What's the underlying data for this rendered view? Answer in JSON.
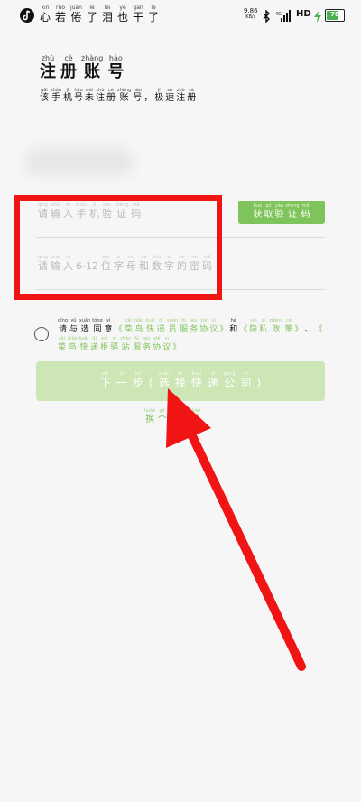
{
  "status_bar": {
    "song": [
      {
        "py": "xīn",
        "han": "心"
      },
      {
        "py": "ruò",
        "han": "若"
      },
      {
        "py": "juàn",
        "han": "倦"
      },
      {
        "py": "le",
        "han": "了"
      },
      {
        "py": "lèi",
        "han": "泪"
      },
      {
        "py": "yě",
        "han": "也"
      },
      {
        "py": "gān",
        "han": "干"
      },
      {
        "py": "le",
        "han": "了"
      }
    ],
    "net_speed_value": "9.86",
    "net_speed_unit": "KB/s",
    "hd": "HD",
    "battery": "78",
    "battery_level": 0.78,
    "icons": [
      "music-icon",
      "bluetooth-icon",
      "signal-icon",
      "charging-icon",
      "battery-icon"
    ]
  },
  "title": [
    {
      "py": "zhù",
      "han": "注"
    },
    {
      "py": "cè",
      "han": "册"
    },
    {
      "py": "zhàng",
      "han": "账"
    },
    {
      "py": "hào",
      "han": "号"
    }
  ],
  "subtitle": [
    {
      "py": "gāi",
      "han": "该"
    },
    {
      "py": "shǒu",
      "han": "手"
    },
    {
      "py": "jī",
      "han": "机"
    },
    {
      "py": "hào",
      "han": "号"
    },
    {
      "py": "wèi",
      "han": "未"
    },
    {
      "py": "zhù",
      "han": "注"
    },
    {
      "py": "cè",
      "han": "册"
    },
    {
      "py": "zhàng",
      "han": "账"
    },
    {
      "py": "hào",
      "han": "号"
    },
    {
      "py": "",
      "han": "，"
    },
    {
      "py": "jí",
      "han": "极"
    },
    {
      "py": "sù",
      "han": "速"
    },
    {
      "py": "zhù",
      "han": "注"
    },
    {
      "py": "cè",
      "han": "册"
    }
  ],
  "code_placeholder": [
    {
      "py": "qǐng",
      "han": "请"
    },
    {
      "py": "shū",
      "han": "输"
    },
    {
      "py": "rù",
      "han": "入"
    },
    {
      "py": "shǒu",
      "han": "手"
    },
    {
      "py": "jī",
      "han": "机"
    },
    {
      "py": "yàn",
      "han": "验"
    },
    {
      "py": "zhèng",
      "han": "证"
    },
    {
      "py": "mǎ",
      "han": "码"
    }
  ],
  "password_placeholder": [
    {
      "py": "qǐng",
      "han": "请"
    },
    {
      "py": "shū",
      "han": "输"
    },
    {
      "py": "rù",
      "han": "入"
    },
    {
      "py": "",
      "han": "6-12"
    },
    {
      "py": "wèi",
      "han": "位"
    },
    {
      "py": "zì",
      "han": "字"
    },
    {
      "py": "mǔ",
      "han": "母"
    },
    {
      "py": "hé",
      "han": "和"
    },
    {
      "py": "shù",
      "han": "数"
    },
    {
      "py": "zì",
      "han": "字"
    },
    {
      "py": "de",
      "han": "的"
    },
    {
      "py": "mì",
      "han": "密"
    },
    {
      "py": "mǎ",
      "han": "码"
    }
  ],
  "get_code_button": [
    {
      "py": "huò",
      "han": "获"
    },
    {
      "py": "qǔ",
      "han": "取"
    },
    {
      "py": "yàn",
      "han": "验"
    },
    {
      "py": "zhèng",
      "han": "证"
    },
    {
      "py": "mǎ",
      "han": "码"
    }
  ],
  "agreement": {
    "prefix": [
      {
        "py": "qǐng",
        "han": "请"
      },
      {
        "py": "yǔ",
        "han": "与"
      },
      {
        "py": "xuǎn",
        "han": "选"
      },
      {
        "py": "tóng",
        "han": "同"
      },
      {
        "py": "yì",
        "han": "意"
      }
    ],
    "link1": [
      {
        "py": "",
        "han": "《"
      },
      {
        "py": "cài",
        "han": "菜"
      },
      {
        "py": "niǎo",
        "han": "鸟"
      },
      {
        "py": "kuài",
        "han": "快"
      },
      {
        "py": "dì",
        "han": "递"
      },
      {
        "py": "yuán",
        "han": "员"
      },
      {
        "py": "fú",
        "han": "服"
      },
      {
        "py": "wù",
        "han": "务"
      },
      {
        "py": "xié",
        "han": "协"
      },
      {
        "py": "yì",
        "han": "议"
      },
      {
        "py": "",
        "han": "》"
      }
    ],
    "and": [
      {
        "py": "hé",
        "han": "和"
      }
    ],
    "link2": [
      {
        "py": "",
        "han": "《"
      },
      {
        "py": "yǐn",
        "han": "隐"
      },
      {
        "py": "sī",
        "han": "私"
      },
      {
        "py": "zhèng",
        "han": "政"
      },
      {
        "py": "cè",
        "han": "策"
      },
      {
        "py": "",
        "han": "》"
      }
    ],
    "sep": [
      {
        "py": "",
        "han": "、"
      }
    ],
    "link3": [
      {
        "py": "",
        "han": "《"
      },
      {
        "py": "cài",
        "han": "菜"
      },
      {
        "py": "niǎo",
        "han": "鸟"
      },
      {
        "py": "kuài",
        "han": "快"
      },
      {
        "py": "dì",
        "han": "递"
      },
      {
        "py": "guì",
        "han": "柜"
      },
      {
        "py": "yì",
        "han": "驿"
      },
      {
        "py": "zhàn",
        "han": "站"
      },
      {
        "py": "fú",
        "han": "服"
      },
      {
        "py": "wù",
        "han": "务"
      },
      {
        "py": "xié",
        "han": "协"
      },
      {
        "py": "yì",
        "han": "议"
      },
      {
        "py": "",
        "han": "》"
      }
    ]
  },
  "next_button": [
    {
      "py": "xià",
      "han": "下"
    },
    {
      "py": "yī",
      "han": "一"
    },
    {
      "py": "bù",
      "han": "步"
    },
    {
      "py": "",
      "han": "("
    },
    {
      "py": "xuǎn",
      "han": "选"
    },
    {
      "py": "zé",
      "han": "择"
    },
    {
      "py": "kuài",
      "han": "快"
    },
    {
      "py": "dì",
      "han": "递"
    },
    {
      "py": "gōng",
      "han": "公"
    },
    {
      "py": "sī",
      "han": "司"
    },
    {
      "py": "",
      "han": ")"
    }
  ],
  "switch_phone": [
    {
      "py": "huàn",
      "han": "换"
    },
    {
      "py": "gè",
      "han": "个"
    },
    {
      "py": "shǒu",
      "han": "手"
    },
    {
      "py": "jī",
      "han": "机"
    },
    {
      "py": "hào",
      "han": "号"
    }
  ],
  "colors": {
    "accent": "#7ec45a",
    "button_disabled": "#cce6b6",
    "highlight": "#f01414",
    "background": "#f6f6f6"
  }
}
